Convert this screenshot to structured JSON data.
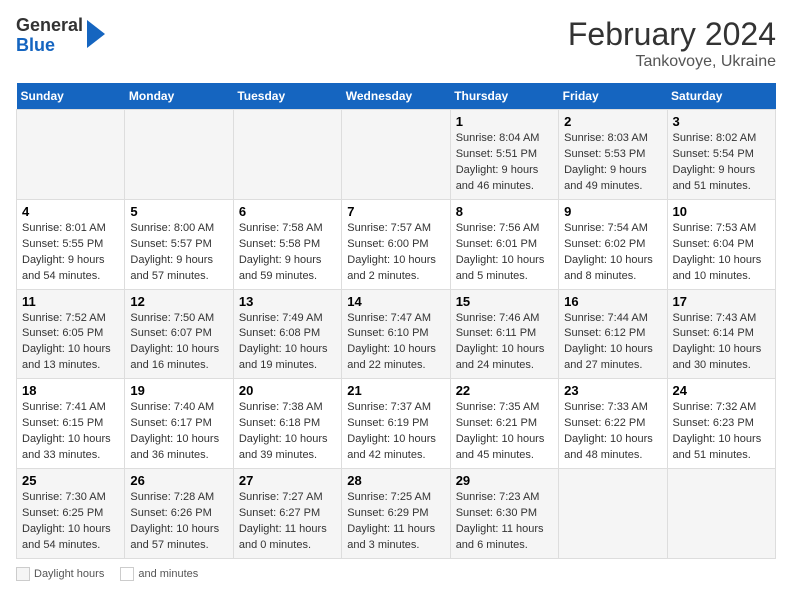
{
  "header": {
    "logo_general": "General",
    "logo_blue": "Blue",
    "title": "February 2024",
    "subtitle": "Tankovoye, Ukraine"
  },
  "calendar": {
    "days_of_week": [
      "Sunday",
      "Monday",
      "Tuesday",
      "Wednesday",
      "Thursday",
      "Friday",
      "Saturday"
    ],
    "weeks": [
      [
        {
          "day": "",
          "info": ""
        },
        {
          "day": "",
          "info": ""
        },
        {
          "day": "",
          "info": ""
        },
        {
          "day": "",
          "info": ""
        },
        {
          "day": "1",
          "info": "Sunrise: 8:04 AM\nSunset: 5:51 PM\nDaylight: 9 hours and 46 minutes."
        },
        {
          "day": "2",
          "info": "Sunrise: 8:03 AM\nSunset: 5:53 PM\nDaylight: 9 hours and 49 minutes."
        },
        {
          "day": "3",
          "info": "Sunrise: 8:02 AM\nSunset: 5:54 PM\nDaylight: 9 hours and 51 minutes."
        }
      ],
      [
        {
          "day": "4",
          "info": "Sunrise: 8:01 AM\nSunset: 5:55 PM\nDaylight: 9 hours and 54 minutes."
        },
        {
          "day": "5",
          "info": "Sunrise: 8:00 AM\nSunset: 5:57 PM\nDaylight: 9 hours and 57 minutes."
        },
        {
          "day": "6",
          "info": "Sunrise: 7:58 AM\nSunset: 5:58 PM\nDaylight: 9 hours and 59 minutes."
        },
        {
          "day": "7",
          "info": "Sunrise: 7:57 AM\nSunset: 6:00 PM\nDaylight: 10 hours and 2 minutes."
        },
        {
          "day": "8",
          "info": "Sunrise: 7:56 AM\nSunset: 6:01 PM\nDaylight: 10 hours and 5 minutes."
        },
        {
          "day": "9",
          "info": "Sunrise: 7:54 AM\nSunset: 6:02 PM\nDaylight: 10 hours and 8 minutes."
        },
        {
          "day": "10",
          "info": "Sunrise: 7:53 AM\nSunset: 6:04 PM\nDaylight: 10 hours and 10 minutes."
        }
      ],
      [
        {
          "day": "11",
          "info": "Sunrise: 7:52 AM\nSunset: 6:05 PM\nDaylight: 10 hours and 13 minutes."
        },
        {
          "day": "12",
          "info": "Sunrise: 7:50 AM\nSunset: 6:07 PM\nDaylight: 10 hours and 16 minutes."
        },
        {
          "day": "13",
          "info": "Sunrise: 7:49 AM\nSunset: 6:08 PM\nDaylight: 10 hours and 19 minutes."
        },
        {
          "day": "14",
          "info": "Sunrise: 7:47 AM\nSunset: 6:10 PM\nDaylight: 10 hours and 22 minutes."
        },
        {
          "day": "15",
          "info": "Sunrise: 7:46 AM\nSunset: 6:11 PM\nDaylight: 10 hours and 24 minutes."
        },
        {
          "day": "16",
          "info": "Sunrise: 7:44 AM\nSunset: 6:12 PM\nDaylight: 10 hours and 27 minutes."
        },
        {
          "day": "17",
          "info": "Sunrise: 7:43 AM\nSunset: 6:14 PM\nDaylight: 10 hours and 30 minutes."
        }
      ],
      [
        {
          "day": "18",
          "info": "Sunrise: 7:41 AM\nSunset: 6:15 PM\nDaylight: 10 hours and 33 minutes."
        },
        {
          "day": "19",
          "info": "Sunrise: 7:40 AM\nSunset: 6:17 PM\nDaylight: 10 hours and 36 minutes."
        },
        {
          "day": "20",
          "info": "Sunrise: 7:38 AM\nSunset: 6:18 PM\nDaylight: 10 hours and 39 minutes."
        },
        {
          "day": "21",
          "info": "Sunrise: 7:37 AM\nSunset: 6:19 PM\nDaylight: 10 hours and 42 minutes."
        },
        {
          "day": "22",
          "info": "Sunrise: 7:35 AM\nSunset: 6:21 PM\nDaylight: 10 hours and 45 minutes."
        },
        {
          "day": "23",
          "info": "Sunrise: 7:33 AM\nSunset: 6:22 PM\nDaylight: 10 hours and 48 minutes."
        },
        {
          "day": "24",
          "info": "Sunrise: 7:32 AM\nSunset: 6:23 PM\nDaylight: 10 hours and 51 minutes."
        }
      ],
      [
        {
          "day": "25",
          "info": "Sunrise: 7:30 AM\nSunset: 6:25 PM\nDaylight: 10 hours and 54 minutes."
        },
        {
          "day": "26",
          "info": "Sunrise: 7:28 AM\nSunset: 6:26 PM\nDaylight: 10 hours and 57 minutes."
        },
        {
          "day": "27",
          "info": "Sunrise: 7:27 AM\nSunset: 6:27 PM\nDaylight: 11 hours and 0 minutes."
        },
        {
          "day": "28",
          "info": "Sunrise: 7:25 AM\nSunset: 6:29 PM\nDaylight: 11 hours and 3 minutes."
        },
        {
          "day": "29",
          "info": "Sunrise: 7:23 AM\nSunset: 6:30 PM\nDaylight: 11 hours and 6 minutes."
        },
        {
          "day": "",
          "info": ""
        },
        {
          "day": "",
          "info": ""
        }
      ]
    ]
  },
  "legend": {
    "daylight_label": "Daylight hours",
    "and_minutes_label": "and minutes"
  }
}
